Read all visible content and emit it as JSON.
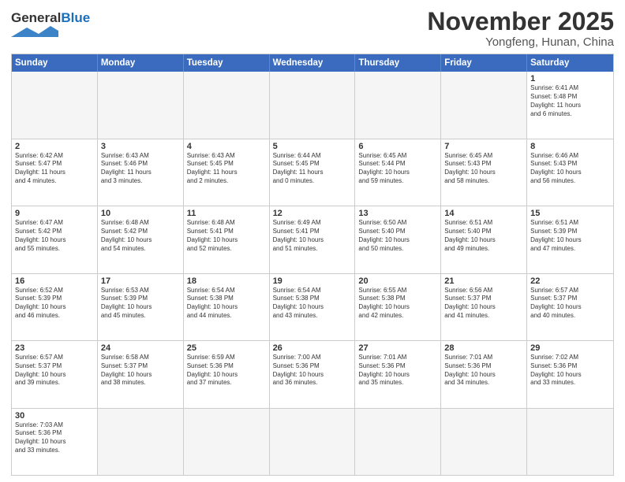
{
  "header": {
    "logo_general": "General",
    "logo_blue": "Blue",
    "month_title": "November 2025",
    "location": "Yongfeng, Hunan, China"
  },
  "days_of_week": [
    "Sunday",
    "Monday",
    "Tuesday",
    "Wednesday",
    "Thursday",
    "Friday",
    "Saturday"
  ],
  "weeks": [
    [
      {
        "num": "",
        "text": "",
        "empty": true
      },
      {
        "num": "",
        "text": "",
        "empty": true
      },
      {
        "num": "",
        "text": "",
        "empty": true
      },
      {
        "num": "",
        "text": "",
        "empty": true
      },
      {
        "num": "",
        "text": "",
        "empty": true
      },
      {
        "num": "",
        "text": "",
        "empty": true
      },
      {
        "num": "1",
        "text": "Sunrise: 6:41 AM\nSunset: 5:48 PM\nDaylight: 11 hours\nand 6 minutes.",
        "empty": false
      }
    ],
    [
      {
        "num": "2",
        "text": "Sunrise: 6:42 AM\nSunset: 5:47 PM\nDaylight: 11 hours\nand 4 minutes.",
        "empty": false
      },
      {
        "num": "3",
        "text": "Sunrise: 6:43 AM\nSunset: 5:46 PM\nDaylight: 11 hours\nand 3 minutes.",
        "empty": false
      },
      {
        "num": "4",
        "text": "Sunrise: 6:43 AM\nSunset: 5:45 PM\nDaylight: 11 hours\nand 2 minutes.",
        "empty": false
      },
      {
        "num": "5",
        "text": "Sunrise: 6:44 AM\nSunset: 5:45 PM\nDaylight: 11 hours\nand 0 minutes.",
        "empty": false
      },
      {
        "num": "6",
        "text": "Sunrise: 6:45 AM\nSunset: 5:44 PM\nDaylight: 10 hours\nand 59 minutes.",
        "empty": false
      },
      {
        "num": "7",
        "text": "Sunrise: 6:45 AM\nSunset: 5:43 PM\nDaylight: 10 hours\nand 58 minutes.",
        "empty": false
      },
      {
        "num": "8",
        "text": "Sunrise: 6:46 AM\nSunset: 5:43 PM\nDaylight: 10 hours\nand 56 minutes.",
        "empty": false
      }
    ],
    [
      {
        "num": "9",
        "text": "Sunrise: 6:47 AM\nSunset: 5:42 PM\nDaylight: 10 hours\nand 55 minutes.",
        "empty": false
      },
      {
        "num": "10",
        "text": "Sunrise: 6:48 AM\nSunset: 5:42 PM\nDaylight: 10 hours\nand 54 minutes.",
        "empty": false
      },
      {
        "num": "11",
        "text": "Sunrise: 6:48 AM\nSunset: 5:41 PM\nDaylight: 10 hours\nand 52 minutes.",
        "empty": false
      },
      {
        "num": "12",
        "text": "Sunrise: 6:49 AM\nSunset: 5:41 PM\nDaylight: 10 hours\nand 51 minutes.",
        "empty": false
      },
      {
        "num": "13",
        "text": "Sunrise: 6:50 AM\nSunset: 5:40 PM\nDaylight: 10 hours\nand 50 minutes.",
        "empty": false
      },
      {
        "num": "14",
        "text": "Sunrise: 6:51 AM\nSunset: 5:40 PM\nDaylight: 10 hours\nand 49 minutes.",
        "empty": false
      },
      {
        "num": "15",
        "text": "Sunrise: 6:51 AM\nSunset: 5:39 PM\nDaylight: 10 hours\nand 47 minutes.",
        "empty": false
      }
    ],
    [
      {
        "num": "16",
        "text": "Sunrise: 6:52 AM\nSunset: 5:39 PM\nDaylight: 10 hours\nand 46 minutes.",
        "empty": false
      },
      {
        "num": "17",
        "text": "Sunrise: 6:53 AM\nSunset: 5:39 PM\nDaylight: 10 hours\nand 45 minutes.",
        "empty": false
      },
      {
        "num": "18",
        "text": "Sunrise: 6:54 AM\nSunset: 5:38 PM\nDaylight: 10 hours\nand 44 minutes.",
        "empty": false
      },
      {
        "num": "19",
        "text": "Sunrise: 6:54 AM\nSunset: 5:38 PM\nDaylight: 10 hours\nand 43 minutes.",
        "empty": false
      },
      {
        "num": "20",
        "text": "Sunrise: 6:55 AM\nSunset: 5:38 PM\nDaylight: 10 hours\nand 42 minutes.",
        "empty": false
      },
      {
        "num": "21",
        "text": "Sunrise: 6:56 AM\nSunset: 5:37 PM\nDaylight: 10 hours\nand 41 minutes.",
        "empty": false
      },
      {
        "num": "22",
        "text": "Sunrise: 6:57 AM\nSunset: 5:37 PM\nDaylight: 10 hours\nand 40 minutes.",
        "empty": false
      }
    ],
    [
      {
        "num": "23",
        "text": "Sunrise: 6:57 AM\nSunset: 5:37 PM\nDaylight: 10 hours\nand 39 minutes.",
        "empty": false
      },
      {
        "num": "24",
        "text": "Sunrise: 6:58 AM\nSunset: 5:37 PM\nDaylight: 10 hours\nand 38 minutes.",
        "empty": false
      },
      {
        "num": "25",
        "text": "Sunrise: 6:59 AM\nSunset: 5:36 PM\nDaylight: 10 hours\nand 37 minutes.",
        "empty": false
      },
      {
        "num": "26",
        "text": "Sunrise: 7:00 AM\nSunset: 5:36 PM\nDaylight: 10 hours\nand 36 minutes.",
        "empty": false
      },
      {
        "num": "27",
        "text": "Sunrise: 7:01 AM\nSunset: 5:36 PM\nDaylight: 10 hours\nand 35 minutes.",
        "empty": false
      },
      {
        "num": "28",
        "text": "Sunrise: 7:01 AM\nSunset: 5:36 PM\nDaylight: 10 hours\nand 34 minutes.",
        "empty": false
      },
      {
        "num": "29",
        "text": "Sunrise: 7:02 AM\nSunset: 5:36 PM\nDaylight: 10 hours\nand 33 minutes.",
        "empty": false
      }
    ],
    [
      {
        "num": "30",
        "text": "Sunrise: 7:03 AM\nSunset: 5:36 PM\nDaylight: 10 hours\nand 33 minutes.",
        "empty": false
      },
      {
        "num": "",
        "text": "",
        "empty": true
      },
      {
        "num": "",
        "text": "",
        "empty": true
      },
      {
        "num": "",
        "text": "",
        "empty": true
      },
      {
        "num": "",
        "text": "",
        "empty": true
      },
      {
        "num": "",
        "text": "",
        "empty": true
      },
      {
        "num": "",
        "text": "",
        "empty": true
      }
    ]
  ]
}
